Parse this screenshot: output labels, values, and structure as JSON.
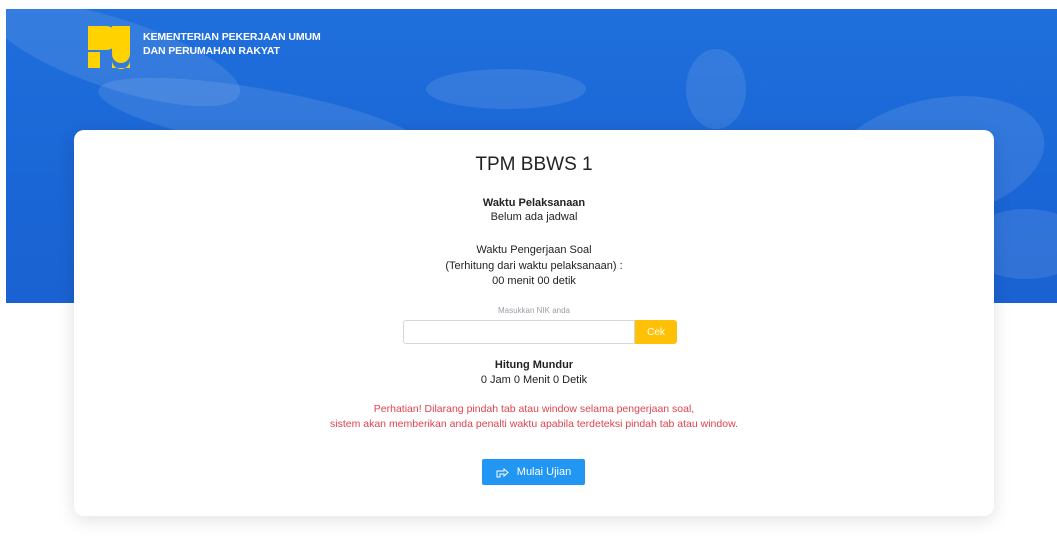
{
  "header": {
    "org_line1": "KEMENTERIAN PEKERJAAN UMUM",
    "org_line2": "DAN PERUMAHAN RAKYAT",
    "logo_icon": "pu-logo-icon",
    "colors": {
      "banner": "#1a66d6",
      "logo_yellow": "#ffd200"
    }
  },
  "card": {
    "title": "TPM BBWS 1",
    "schedule_label": "Waktu Pelaksanaan",
    "schedule_value": "Belum ada jadwal",
    "duration_label": "Waktu Pengerjaan Soal",
    "duration_note": "(Terhitung dari waktu pelaksanaan) :",
    "duration_value": "00 menit 00 detik",
    "nik_label": "Masukkan NIK anda",
    "nik_value": "",
    "check_button": "Cek",
    "countdown_label": "Hitung Mundur",
    "countdown_value": "0 Jam 0 Menit 0 Detik",
    "warning_line1": "Perhatian! Dilarang pindah tab atau window selama pengerjaan soal,",
    "warning_line2": "sistem akan memberikan anda penalti waktu apabila terdeteksi pindah tab atau window.",
    "start_button": "Mulai Ujian",
    "start_icon": "hand-pointer-icon",
    "colors": {
      "warning": "#e0434f",
      "check": "#ffc107",
      "start": "#2196f3"
    }
  }
}
